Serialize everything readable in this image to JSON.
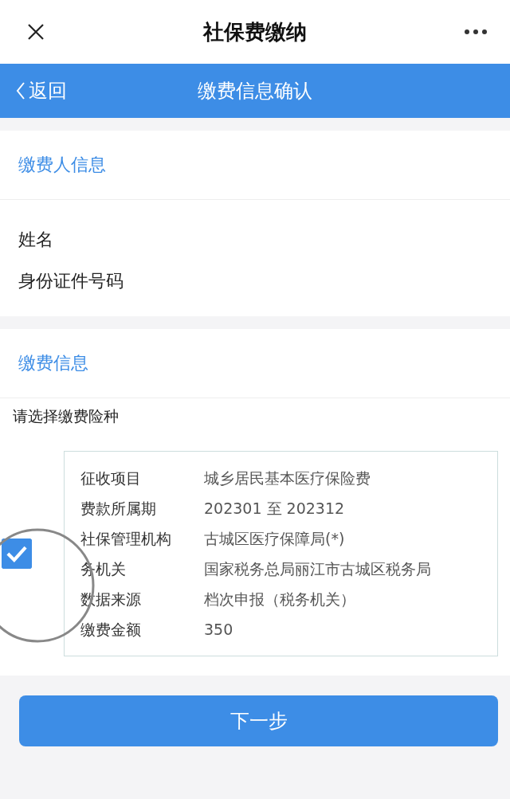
{
  "top_bar": {
    "title": "社保费缴纳"
  },
  "nav_bar": {
    "back": "返回",
    "title": "缴费信息确认"
  },
  "payer_section": {
    "heading": "缴费人信息",
    "fields": [
      {
        "label": "姓名"
      },
      {
        "label": "身份证件号码"
      }
    ]
  },
  "payment_section": {
    "heading": "缴费信息",
    "prompt": "请选择缴费险种",
    "items": [
      {
        "checked": true,
        "rows": [
          {
            "label": "征收项目",
            "value": "城乡居民基本医疗保险费"
          },
          {
            "label": "费款所属期",
            "value": "202301 至 202312"
          },
          {
            "label": "社保管理机构",
            "value": "古城区医疗保障局(*)"
          },
          {
            "label": "务机关",
            "value": "国家税务总局丽江市古城区税务局"
          },
          {
            "label": "数据来源",
            "value": "档次申报（税务机关）"
          },
          {
            "label": "缴费金额",
            "value": "350"
          }
        ]
      }
    ]
  },
  "next_button": "下一步"
}
